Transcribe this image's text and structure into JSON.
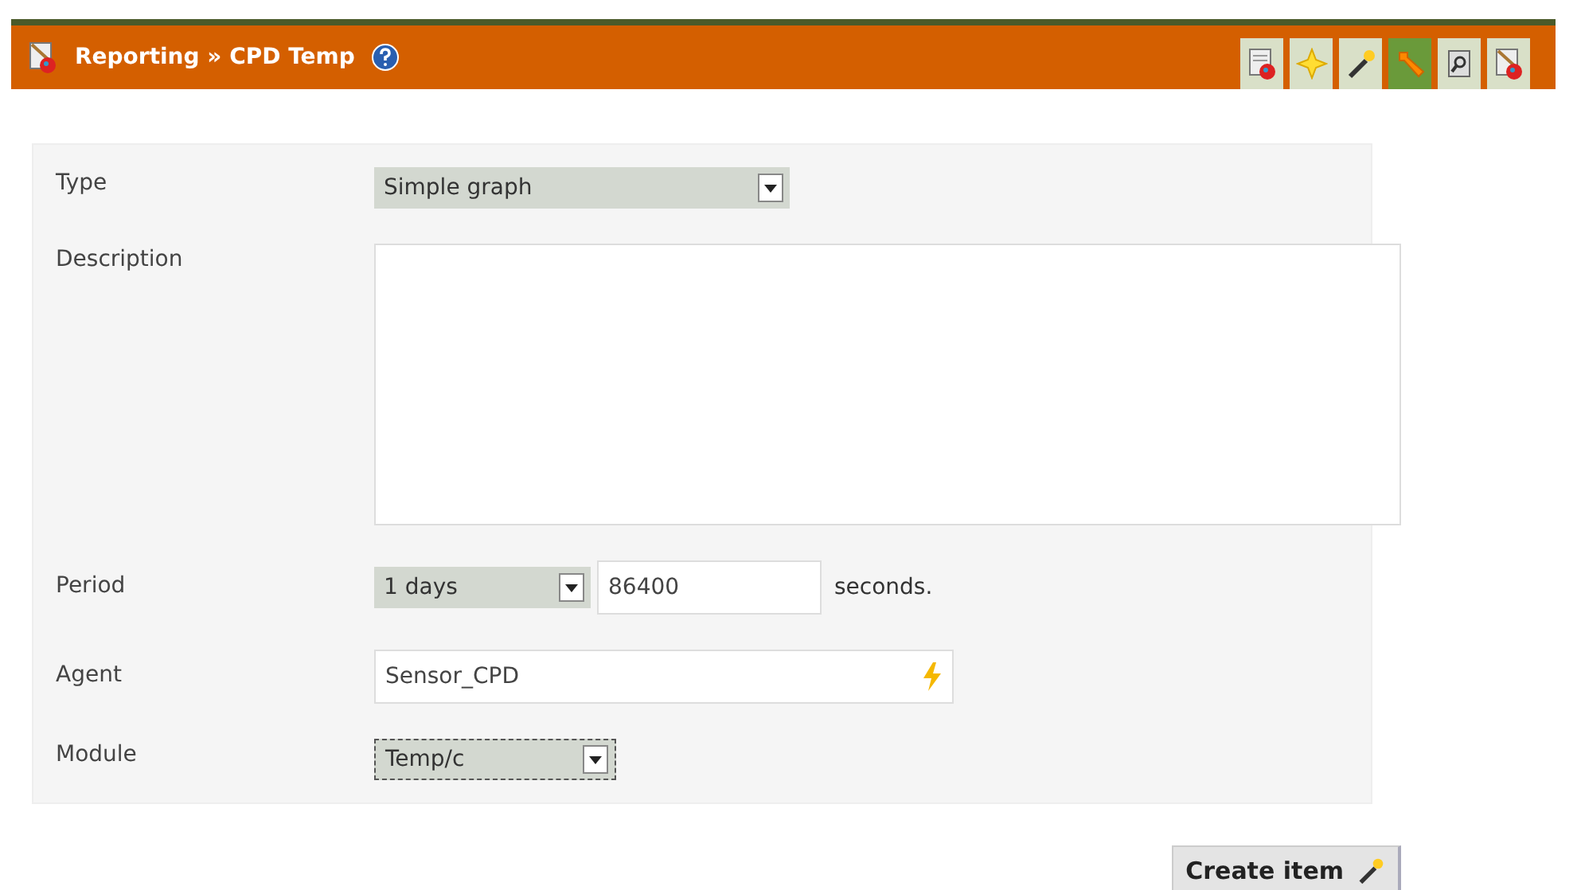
{
  "header": {
    "title": "Reporting » CPD Temp"
  },
  "toolbar": [
    {
      "kind": "report",
      "selected": false
    },
    {
      "kind": "star",
      "selected": false
    },
    {
      "kind": "wand",
      "selected": false
    },
    {
      "kind": "wrench",
      "selected": true
    },
    {
      "kind": "scroll",
      "selected": false
    },
    {
      "kind": "palette",
      "selected": false
    }
  ],
  "form": {
    "type": {
      "label": "Type",
      "value": "Simple graph"
    },
    "description": {
      "label": "Description"
    },
    "period": {
      "label": "Period",
      "value": "1 days",
      "seconds": "86400",
      "unit": "seconds."
    },
    "agent": {
      "label": "Agent",
      "value": "Sensor_CPD"
    },
    "module": {
      "label": "Module",
      "value": "Temp/c",
      "focused": true
    }
  },
  "button": {
    "label": "Create item"
  }
}
